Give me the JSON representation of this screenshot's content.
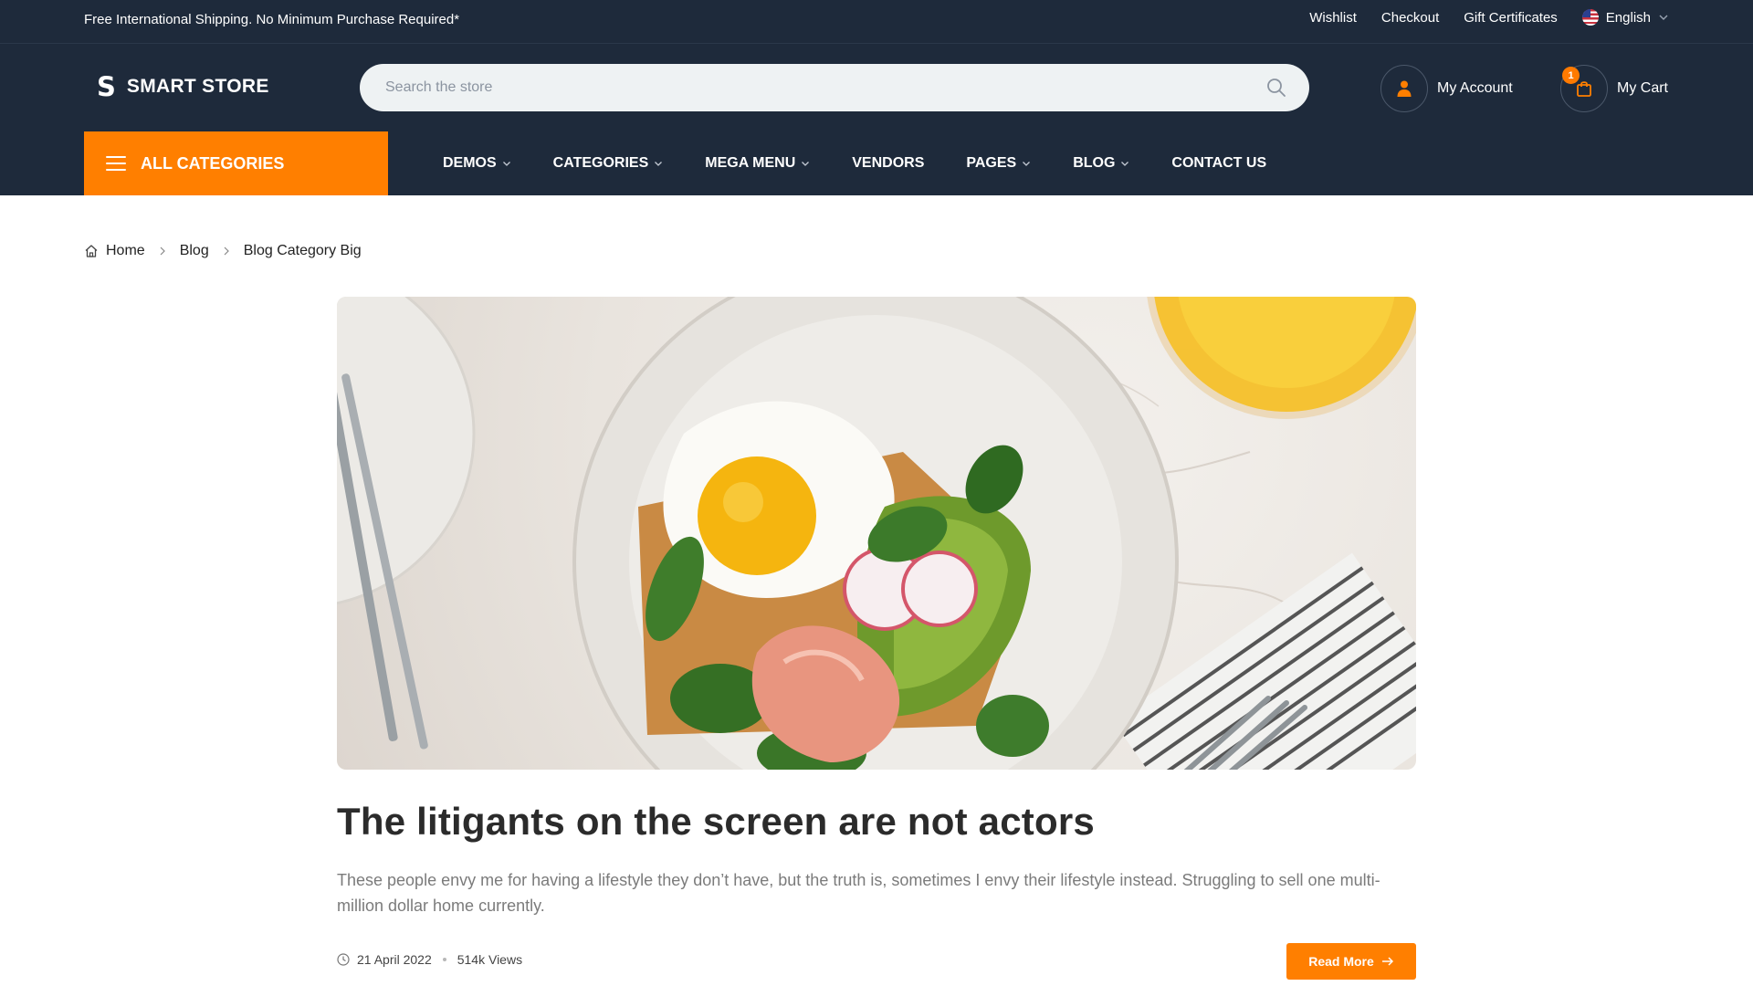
{
  "topbar": {
    "promo": "Free International Shipping. No Minimum Purchase Required*",
    "links": [
      "Wishlist",
      "Checkout",
      "Gift Certificates"
    ],
    "language": "English"
  },
  "header": {
    "logo_mark": "S",
    "logo_text": "SMART STORE",
    "search_placeholder": "Search the store",
    "account_label": "My Account",
    "cart_label": "My Cart",
    "cart_count": "1"
  },
  "nav": {
    "all_categories": "ALL CATEGORIES",
    "items": [
      "DEMOS",
      "CATEGORIES",
      "MEGA MENU",
      "VENDORS",
      "PAGES",
      "BLOG",
      "CONTACT US"
    ]
  },
  "breadcrumb": [
    "Home",
    "Blog",
    "Blog Category Big"
  ],
  "post": {
    "title": "The litigants on the screen are not actors",
    "excerpt": "These people envy me for having a lifestyle they don’t have, but the truth is, sometimes I envy their lifestyle instead. Struggling to sell one multi-million dollar home currently.",
    "date": "21 April 2022",
    "views": "514k Views",
    "read_more": "Read More"
  },
  "colors": {
    "header_bg": "#1e2a3b",
    "accent": "#ff7f00"
  }
}
